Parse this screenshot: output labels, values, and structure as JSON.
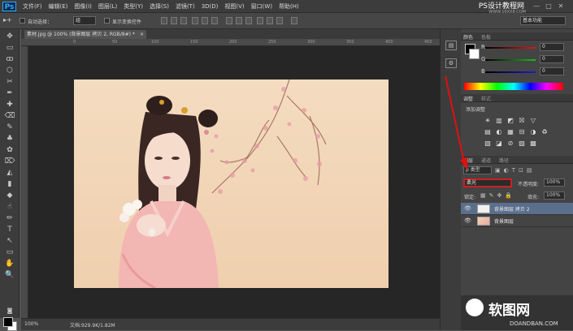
{
  "app": {
    "logo": "Ps"
  },
  "menu": [
    "文件(F)",
    "编辑(E)",
    "图像(I)",
    "图层(L)",
    "类型(Y)",
    "选择(S)",
    "滤镜(T)",
    "3D(D)",
    "视图(V)",
    "窗口(W)",
    "帮助(H)"
  ],
  "watermark_top": {
    "title": "PS设计教程网",
    "url": "WWW.16XX8.COM"
  },
  "window_controls": [
    "—",
    "□",
    "✕"
  ],
  "options": {
    "auto_select_label": "自动选择：",
    "auto_select_value": "组",
    "show_transform_label": "显示变换控件",
    "workspace": "基本功能"
  },
  "document_tab": {
    "title": "素材.jpg @ 100% (背景图层 拷贝 2, RGB/8#) *",
    "close": "×"
  },
  "ruler_marks": [
    "0",
    "50",
    "100",
    "150",
    "200",
    "250",
    "300",
    "350",
    "400",
    "450"
  ],
  "status": {
    "zoom": "100%",
    "doc_info": "文档:929.9K/1.82M"
  },
  "color_panel": {
    "tabs": [
      "颜色",
      "色板"
    ],
    "channels": [
      {
        "label": "R",
        "value": "0",
        "color": "#e01818"
      },
      {
        "label": "G",
        "value": "0",
        "color": "#18c018"
      },
      {
        "label": "B",
        "value": "0",
        "color": "#1a1ad8"
      }
    ]
  },
  "adjustments_panel": {
    "tabs": [
      "调整",
      "样式"
    ],
    "add_label": "添加调整",
    "icons": [
      "☀",
      "▥",
      "◩",
      "☒",
      "▽",
      "▤",
      "◐",
      "▦",
      "⊟",
      "◑",
      "♻",
      "▧",
      "◪",
      "⊘",
      "▨",
      "▩",
      "◫",
      "▣"
    ]
  },
  "layers_panel": {
    "tabs": [
      "图层",
      "通道",
      "路径"
    ],
    "filter_label": "ρ 类型",
    "blend_mode": "柔光",
    "opacity_label": "不透明度:",
    "opacity_value": "100%",
    "lock_label": "锁定:",
    "fill_label": "填充:",
    "fill_value": "100%",
    "layers": [
      {
        "name": "背景图层 拷贝 2",
        "selected": true
      },
      {
        "name": "背景图层",
        "selected": false
      }
    ]
  },
  "watermark_bottom": {
    "brand": "软图网",
    "url": "DOANDBAN.COM"
  },
  "tools": [
    "✥",
    "▭",
    "ꝏ",
    "⬡",
    "✂",
    "✒",
    "✚",
    "⌫",
    "✎",
    "♣",
    "✿",
    "⌦",
    "◭",
    "▮",
    "◆",
    "☝",
    "✏",
    "T",
    "↖",
    "▭",
    "✋",
    "🔍"
  ]
}
